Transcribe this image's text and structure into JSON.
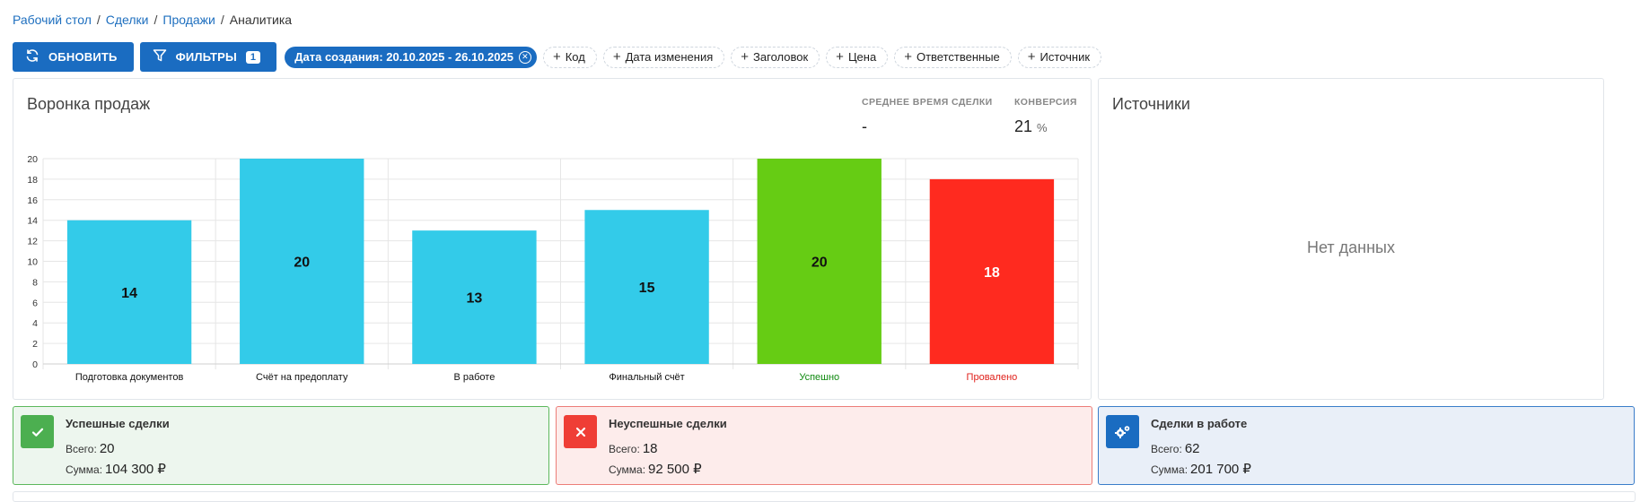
{
  "breadcrumb": {
    "items": [
      "Рабочий стол",
      "Сделки",
      "Продажи"
    ],
    "sep": "/",
    "current": "Аналитика"
  },
  "toolbar": {
    "refresh_label": "ОБНОВИТЬ",
    "filters_label": "ФИЛЬТРЫ",
    "filters_count": "1",
    "active_filter": "Дата создания: 20.10.2025 - 26.10.2025",
    "chips": [
      "Код",
      "Дата изменения",
      "Заголовок",
      "Цена",
      "Ответственные",
      "Источник"
    ]
  },
  "funnel": {
    "title": "Воронка продаж",
    "avg_time_label": "СРЕДНЕЕ ВРЕМЯ СДЕЛКИ",
    "avg_time_value": "-",
    "conversion_label": "КОНВЕРСИЯ",
    "conversion_value": "21",
    "conversion_unit": "%"
  },
  "sources": {
    "title": "Источники",
    "empty": "Нет данных"
  },
  "chart_data": {
    "type": "bar",
    "categories": [
      "Подготовка документов",
      "Счёт на предоплату",
      "В работе",
      "Финальный счёт",
      "Успешно",
      "Провалено"
    ],
    "values": [
      14,
      20,
      13,
      15,
      20,
      18
    ],
    "colors": [
      "#33cbe9",
      "#33cbe9",
      "#33cbe9",
      "#33cbe9",
      "#66cc14",
      "#ff2a1f"
    ],
    "label_colors": [
      "#111111",
      "#111111",
      "#111111",
      "#111111",
      "#118a11",
      "#e0201a"
    ],
    "value_label_colors": [
      "#111111",
      "#111111",
      "#111111",
      "#111111",
      "#111111",
      "#ffffff"
    ],
    "yticks": [
      0,
      2,
      4,
      6,
      8,
      10,
      12,
      14,
      16,
      18,
      20
    ],
    "ylim": [
      0,
      20
    ],
    "grid": true
  },
  "cards": {
    "success": {
      "title": "Успешные сделки",
      "total_label": "Всего:",
      "total": "20",
      "sum_label": "Сумма:",
      "sum": "104 300 ₽"
    },
    "fail": {
      "title": "Неуспешные сделки",
      "total_label": "Всего:",
      "total": "18",
      "sum_label": "Сумма:",
      "sum": "92 500 ₽"
    },
    "work": {
      "title": "Сделки в работе",
      "total_label": "Всего:",
      "total": "62",
      "sum_label": "Сумма:",
      "sum": "201 700 ₽"
    }
  }
}
